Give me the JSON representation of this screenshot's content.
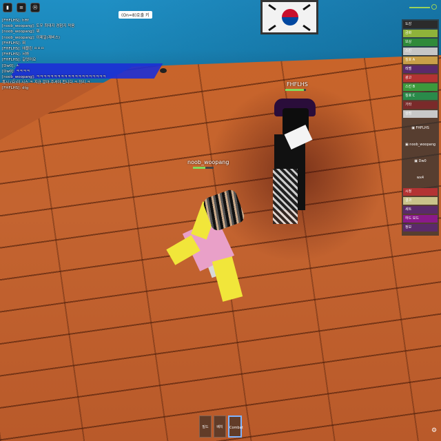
{
  "hud": {
    "top_icons": [
      "▮",
      "≡",
      "Ⓗ"
    ],
    "pill_text": "(On=8)호출 키"
  },
  "chat": [
    "[FHFLHS]: hHf",
    "[noob_woopang]: 도우 최대지 경험지 적음",
    "[noob_woopang]: 뭐",
    "[noob_woopang]: 이제일(재비스)",
    "[FHFLHS]: 뭐",
    "[FHFLHS]: 에블린 ㅁㅁㅁ",
    "[FHFLHS]: 서봐",
    "[FHFLHS]: 길엇어요",
    "[Dw0]: ㅗ",
    "[Dw0]: ㅋㅋㅋㅋ",
    "[noob_woopang]: ㅋㅋㅋㅋㅋㅋㅋㅋㅋㅋㅋㅋㅋㅋㅋㅋㅋㅋㅋㅋ",
    "혹시 (요)이 시스 ㅋ 지금 알아 주셔야 합니다 ㅋ 정리 ㅋ",
    "[FHFLHS]: dtg"
  ],
  "players": [
    {
      "name": "FHFLHS",
      "hp": 0.9
    },
    {
      "name": "noob_woopang",
      "hp": 0.6
    }
  ],
  "panel": {
    "rows": [
      {
        "label": "도감",
        "color": "#2b2b2b"
      },
      {
        "label": "금화",
        "color": "#8fb33a"
      },
      {
        "label": "보상",
        "color": "#2f8a3a"
      },
      {
        "label": "스킨",
        "color": "#c6c6c6"
      },
      {
        "label": "칭호 A",
        "color": "#c9a048"
      },
      {
        "label": "레벨",
        "color": "#5b2a6a"
      },
      {
        "label": "광고",
        "color": "#b33333"
      },
      {
        "label": "스킨 B",
        "color": "#3c9a3c"
      },
      {
        "label": "칭호 C",
        "color": "#2a8a4a"
      },
      {
        "label": "기타",
        "color": "#7a2a2a"
      },
      {
        "label": "상점",
        "color": "#c8c8c8"
      }
    ],
    "entries": [
      {
        "text": "FHFLHS",
        "icon": "avatar-icon"
      },
      {
        "text": "noob_woopang",
        "icon": "avatar-icon"
      },
      {
        "text": "Dw0",
        "icon": "avatar-icon"
      },
      {
        "text": "wx4",
        "icon": ""
      }
    ],
    "bottom_rows": [
      {
        "label": "시청",
        "color": "#b33333"
      },
      {
        "label": "결과",
        "color": "#c9c38a"
      },
      {
        "label": "세트",
        "color": "#5b2a6a"
      },
      {
        "label": "하드 모드",
        "color": "#8a1a8a"
      },
      {
        "label": "정보",
        "color": "#5b2a6a"
      }
    ]
  },
  "hotbar": [
    {
      "label": "빌드",
      "active": false
    },
    {
      "label": "배치",
      "active": false
    },
    {
      "label": "Combat",
      "active": true
    }
  ]
}
